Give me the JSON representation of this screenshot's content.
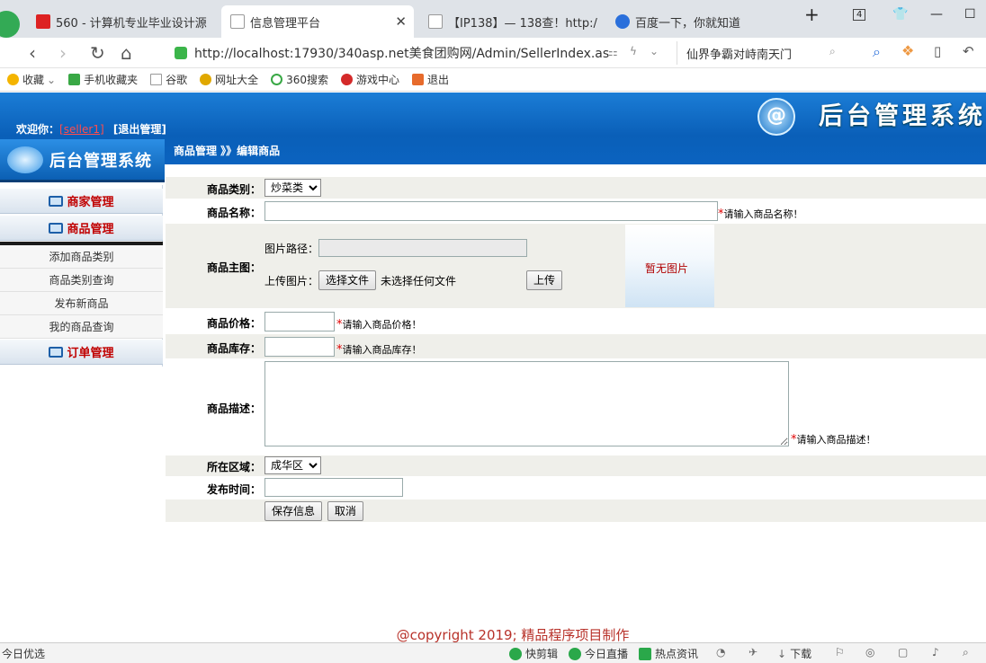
{
  "browser": {
    "tabs": [
      {
        "title": "560 - 计算机专业毕业设计源",
        "active": false
      },
      {
        "title": "信息管理平台",
        "active": true
      },
      {
        "title": "【IP138】— 138查！http:/",
        "active": false
      },
      {
        "title": "百度一下，你就知道",
        "active": false
      }
    ],
    "tab_count": "4",
    "url": "http://localhost:17930/340asp.net美食团购网/Admin/SellerIndex.as",
    "search_text": "仙界争霸对峙南天门",
    "bookmarks": [
      "收藏",
      "手机收藏夹",
      "谷歌",
      "网址大全",
      "360搜索",
      "游戏中心",
      "退出"
    ]
  },
  "header": {
    "system_title": "后台管理系统",
    "welcome_label": "欢迎你：",
    "username": "[seller1]",
    "logout": "[退出管理]",
    "breadcrumb": "商品管理 》》编辑商品"
  },
  "sidebar": {
    "logo_text": "后台管理系统",
    "groups": [
      {
        "label": "商家管理"
      },
      {
        "label": "商品管理",
        "items": [
          "添加商品类别",
          "商品类别查询",
          "发布新商品",
          "我的商品查询"
        ]
      },
      {
        "label": "订单管理"
      }
    ]
  },
  "form": {
    "category_label": "商品类别：",
    "category_value": "炒菜类",
    "name_label": "商品名称：",
    "name_hint": "请输入商品名称！",
    "image_label": "商品主图：",
    "image_path_label": "图片路径：",
    "upload_label": "上传图片：",
    "choose_file": "选择文件",
    "no_file": "未选择任何文件",
    "upload_button": "上传",
    "no_image": "暂无图片",
    "price_label": "商品价格：",
    "price_hint": "请输入商品价格！",
    "stock_label": "商品库存：",
    "stock_hint": "请输入商品库存！",
    "desc_label": "商品描述：",
    "desc_hint": "请输入商品描述！",
    "region_label": "所在区域：",
    "region_value": "成华区",
    "time_label": "发布时间：",
    "save_button": "保存信息",
    "cancel_button": "取消",
    "required_mark": "*"
  },
  "footer": {
    "copyright": "@copyright 2019; 精品程序项目制作"
  },
  "statusbar": {
    "left": "今日优选",
    "items": [
      "快剪辑",
      "今日直播",
      "热点资讯",
      "下载"
    ]
  },
  "colors": {
    "header_blue": "#0a5fb8",
    "menu_head_text": "#c00000",
    "required_red": "#e00000",
    "row_alt": "#efefea"
  }
}
